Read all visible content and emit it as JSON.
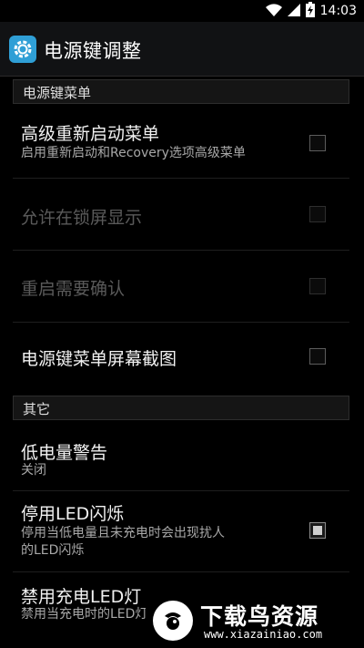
{
  "status_bar": {
    "time": "14:03",
    "icons": [
      "wifi-icon",
      "signal-icon",
      "battery-charging-icon"
    ]
  },
  "action_bar": {
    "title": "电源键调整",
    "icon": "settings-gear-icon",
    "accent": "#2f9fd6"
  },
  "sections": [
    {
      "header": "电源键菜单"
    },
    {
      "header": "其它"
    }
  ],
  "prefs": {
    "advanced_reboot": {
      "title": "高级重新启动菜单",
      "summary": "启用重新启动和Recovery选项高级菜单",
      "checked": false,
      "enabled": true
    },
    "lockscreen": {
      "title": "允许在锁屏显示",
      "checked": false,
      "enabled": false
    },
    "reboot_confirm": {
      "title": "重启需要确认",
      "checked": false,
      "enabled": false
    },
    "screenshot": {
      "title": "电源键菜单屏幕截图",
      "checked": false,
      "enabled": true
    },
    "low_battery": {
      "title": "低电量警告",
      "summary": "关闭"
    },
    "disable_led_flash": {
      "title": "停用LED闪烁",
      "summary_line1": "停用当低电量且未充电时会出现扰人",
      "summary_line2": "的LED闪烁",
      "checked": true,
      "enabled": true
    },
    "disable_charge_led": {
      "title": "禁用充电LED灯",
      "summary": "禁用当充电时的LED灯"
    }
  },
  "watermark": {
    "text": "下载鸟资源",
    "url": "www.xiazainiao.com"
  }
}
